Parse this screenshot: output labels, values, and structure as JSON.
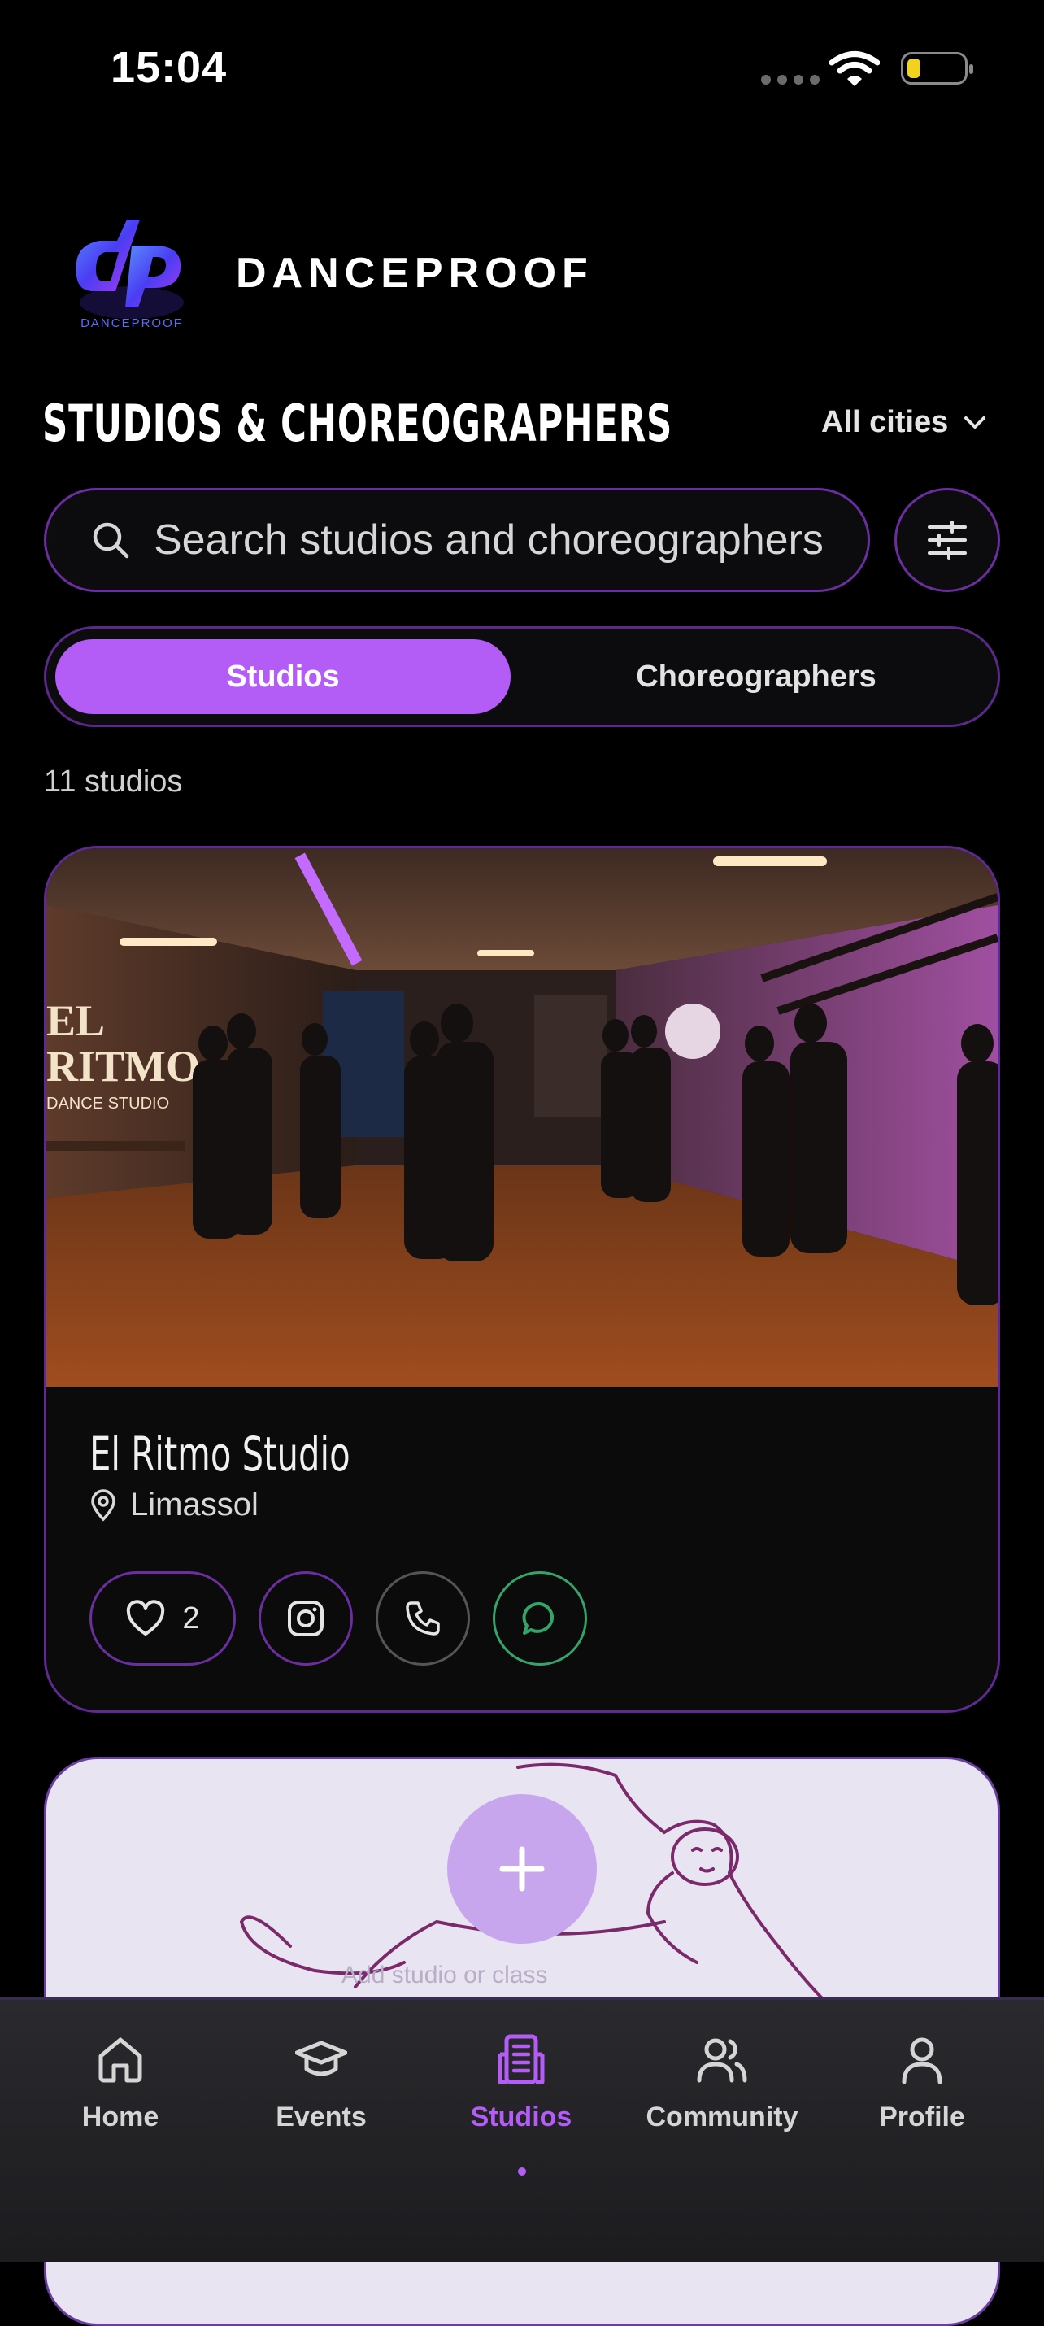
{
  "status_bar": {
    "time": "15:04"
  },
  "header": {
    "brand": "DANCEPROOF",
    "logo_caption": "DANCEPROOF"
  },
  "page": {
    "title": "STUDIOS & CHOREOGRAPHERS",
    "city_filter": "All cities"
  },
  "search": {
    "placeholder": "Search studios and choreographers"
  },
  "segment": {
    "active": "Studios",
    "inactive": "Choreographers"
  },
  "results": {
    "count_label": "11 studios"
  },
  "studio_card": {
    "name": "El Ritmo Studio",
    "location": "Limassol",
    "likes": "2",
    "photo_sign": [
      "EL",
      "RITMO",
      "DANCE STUDIO"
    ]
  },
  "add_card": {
    "hint": "Add studio or class"
  },
  "tabs": [
    {
      "label": "Home",
      "icon": "home-icon"
    },
    {
      "label": "Events",
      "icon": "graduation-cap-icon"
    },
    {
      "label": "Studios",
      "icon": "building-icon"
    },
    {
      "label": "Community",
      "icon": "users-icon"
    },
    {
      "label": "Profile",
      "icon": "user-icon"
    }
  ],
  "colors": {
    "accent": "#b45cf6",
    "border": "#6a2e9e",
    "chat": "#35a36a"
  }
}
